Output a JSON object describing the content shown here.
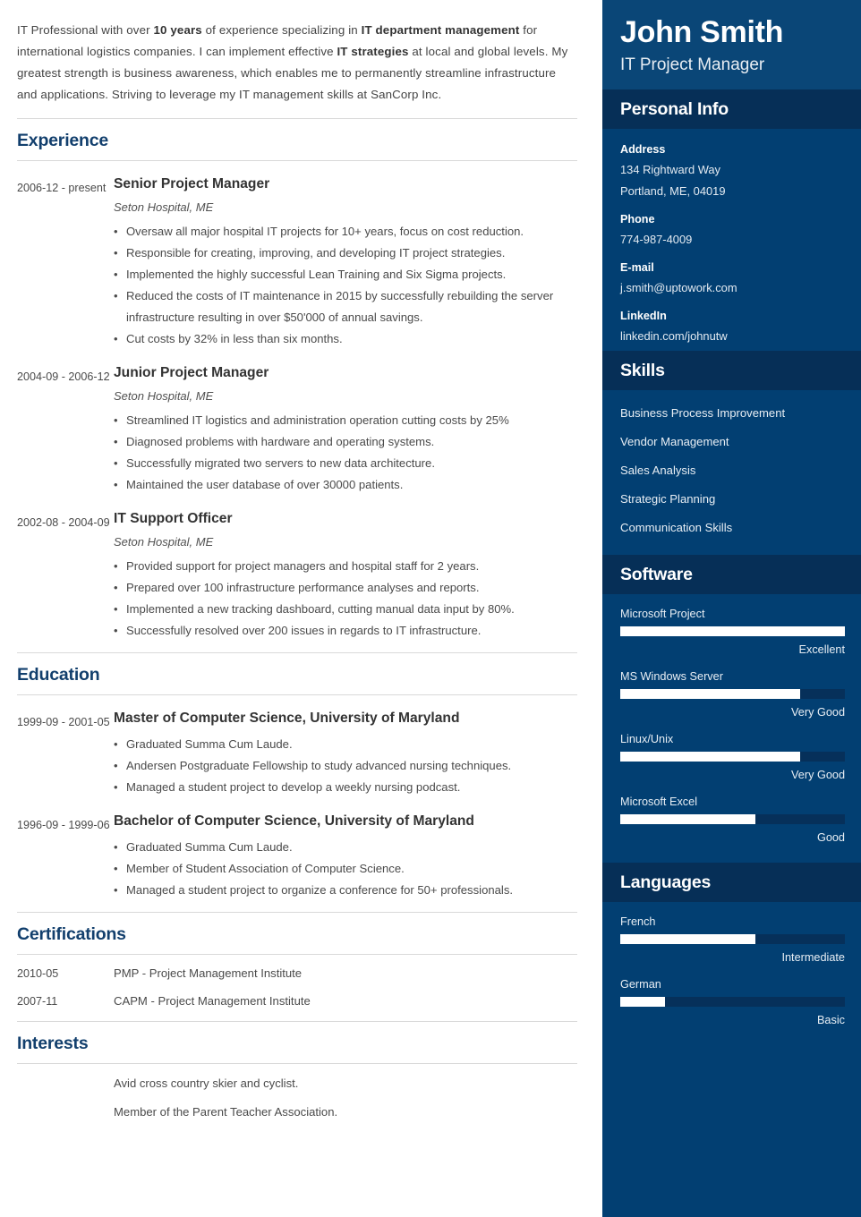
{
  "colors": {
    "sidebar_bg": "#023f72",
    "sidebar_header_bg": "#0a4677",
    "sidebar_band_bg": "#062f57",
    "heading_blue": "#123f6d",
    "bar_fill": "#ffffff",
    "bar_track": "#06305a"
  },
  "summary": {
    "part1": "IT Professional with over ",
    "bold1": "10 years",
    "part2": " of experience specializing in ",
    "bold2": "IT department management",
    "part3": " for international logistics companies. I can implement effective ",
    "bold3": "IT strategies",
    "part4": " at local and global levels. My greatest strength is business awareness, which enables me to permanently streamline infrastructure and applications. Striving to leverage my IT management skills at SanCorp Inc."
  },
  "sections": {
    "experience_title": "Experience",
    "education_title": "Education",
    "certifications_title": "Certifications",
    "interests_title": "Interests"
  },
  "experience": [
    {
      "date": "2006-12 - present",
      "title": "Senior Project Manager",
      "company": "Seton Hospital, ME",
      "bullets": [
        "Oversaw all major hospital IT projects for 10+ years, focus on cost reduction.",
        "Responsible for creating, improving, and developing IT project strategies.",
        "Implemented the highly successful Lean Training and Six Sigma projects.",
        "Reduced the costs of IT maintenance in 2015 by successfully rebuilding the server infrastructure resulting in over $50'000 of annual savings.",
        "Cut costs by 32% in less than six months."
      ]
    },
    {
      "date": "2004-09 - 2006-12",
      "title": "Junior Project Manager",
      "company": "Seton Hospital, ME",
      "bullets": [
        "Streamlined IT logistics and administration operation cutting costs by 25%",
        "Diagnosed problems with hardware and operating systems.",
        "Successfully migrated two servers to new data architecture.",
        "Maintained the user database of over 30000 patients."
      ]
    },
    {
      "date": "2002-08 - 2004-09",
      "title": "IT Support Officer",
      "company": "Seton Hospital, ME",
      "bullets": [
        "Provided support for project managers and hospital staff for 2 years.",
        "Prepared over 100 infrastructure performance analyses and reports.",
        "Implemented a new tracking dashboard, cutting manual data input by 80%.",
        "Successfully resolved over 200 issues in regards to IT infrastructure."
      ]
    }
  ],
  "education": [
    {
      "date": "1999-09 - 2001-05",
      "title": "Master of Computer Science, University of Maryland",
      "bullets": [
        "Graduated Summa Cum Laude.",
        "Andersen Postgraduate Fellowship to study advanced nursing techniques.",
        "Managed a student project to develop a weekly nursing podcast."
      ]
    },
    {
      "date": "1996-09 - 1999-06",
      "title": "Bachelor of Computer Science, University of Maryland",
      "bullets": [
        "Graduated Summa Cum Laude.",
        "Member of Student Association of Computer Science.",
        "Managed a student project to organize a conference for 50+ professionals."
      ]
    }
  ],
  "certifications": [
    {
      "date": "2010-05",
      "text": "PMP - Project Management Institute"
    },
    {
      "date": "2007-11",
      "text": "CAPM - Project Management Institute"
    }
  ],
  "interests": [
    "Avid cross country skier and cyclist.",
    "Member of the Parent Teacher Association."
  ],
  "sidebar": {
    "name": "John Smith",
    "role": "IT Project Manager",
    "personal_info": {
      "title": "Personal Info",
      "fields": [
        {
          "label": "Address",
          "value_line1": "134 Rightward Way",
          "value_line2": "Portland, ME, 04019"
        },
        {
          "label": "Phone",
          "value_line1": "774-987-4009"
        },
        {
          "label": "E-mail",
          "value_line1": "j.smith@uptowork.com"
        },
        {
          "label": "LinkedIn",
          "value_line1": "linkedin.com/johnutw"
        }
      ]
    },
    "skills": {
      "title": "Skills",
      "items": [
        "Business Process Improvement",
        "Vendor Management",
        "Sales Analysis",
        "Strategic Planning",
        "Communication Skills"
      ]
    },
    "software": {
      "title": "Software",
      "items": [
        {
          "label": "Microsoft Project",
          "level": 100,
          "caption": "Excellent"
        },
        {
          "label": "MS Windows Server",
          "level": 80,
          "caption": "Very Good"
        },
        {
          "label": "Linux/Unix",
          "level": 80,
          "caption": "Very Good"
        },
        {
          "label": "Microsoft Excel",
          "level": 60,
          "caption": "Good"
        }
      ]
    },
    "languages": {
      "title": "Languages",
      "items": [
        {
          "label": "French",
          "level": 60,
          "caption": "Intermediate"
        },
        {
          "label": "German",
          "level": 20,
          "caption": "Basic"
        }
      ]
    }
  }
}
